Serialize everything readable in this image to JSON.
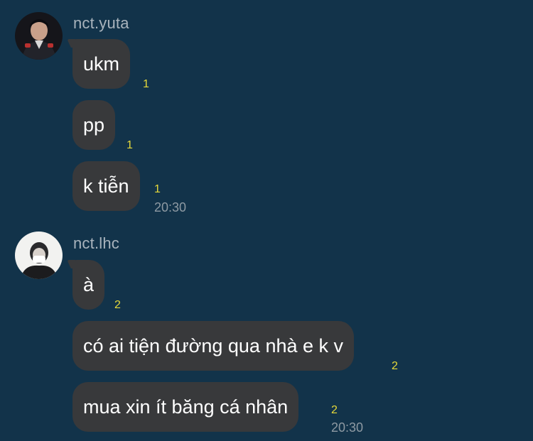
{
  "groups": [
    {
      "sender": "nct.yuta",
      "avatar_icon": "profile-photo-icon",
      "messages": [
        {
          "text": "ukm",
          "unread": "1"
        },
        {
          "text": "pp",
          "unread": "1"
        },
        {
          "text": "k tiễn",
          "unread": "1",
          "time": "20:30"
        }
      ]
    },
    {
      "sender": "nct.lhc",
      "avatar_icon": "profile-photo-icon",
      "messages": [
        {
          "text": "à",
          "unread": "2"
        },
        {
          "text": "có ai tiện đường qua nhà e k v",
          "unread": "2"
        },
        {
          "text": "mua xin ít băng cá nhân",
          "unread": "2",
          "time": "20:30"
        }
      ]
    }
  ],
  "colors": {
    "background": "#12334a",
    "bubble": "#38393b",
    "unread": "#e6d93a",
    "meta_text": "#8e9aa3"
  }
}
